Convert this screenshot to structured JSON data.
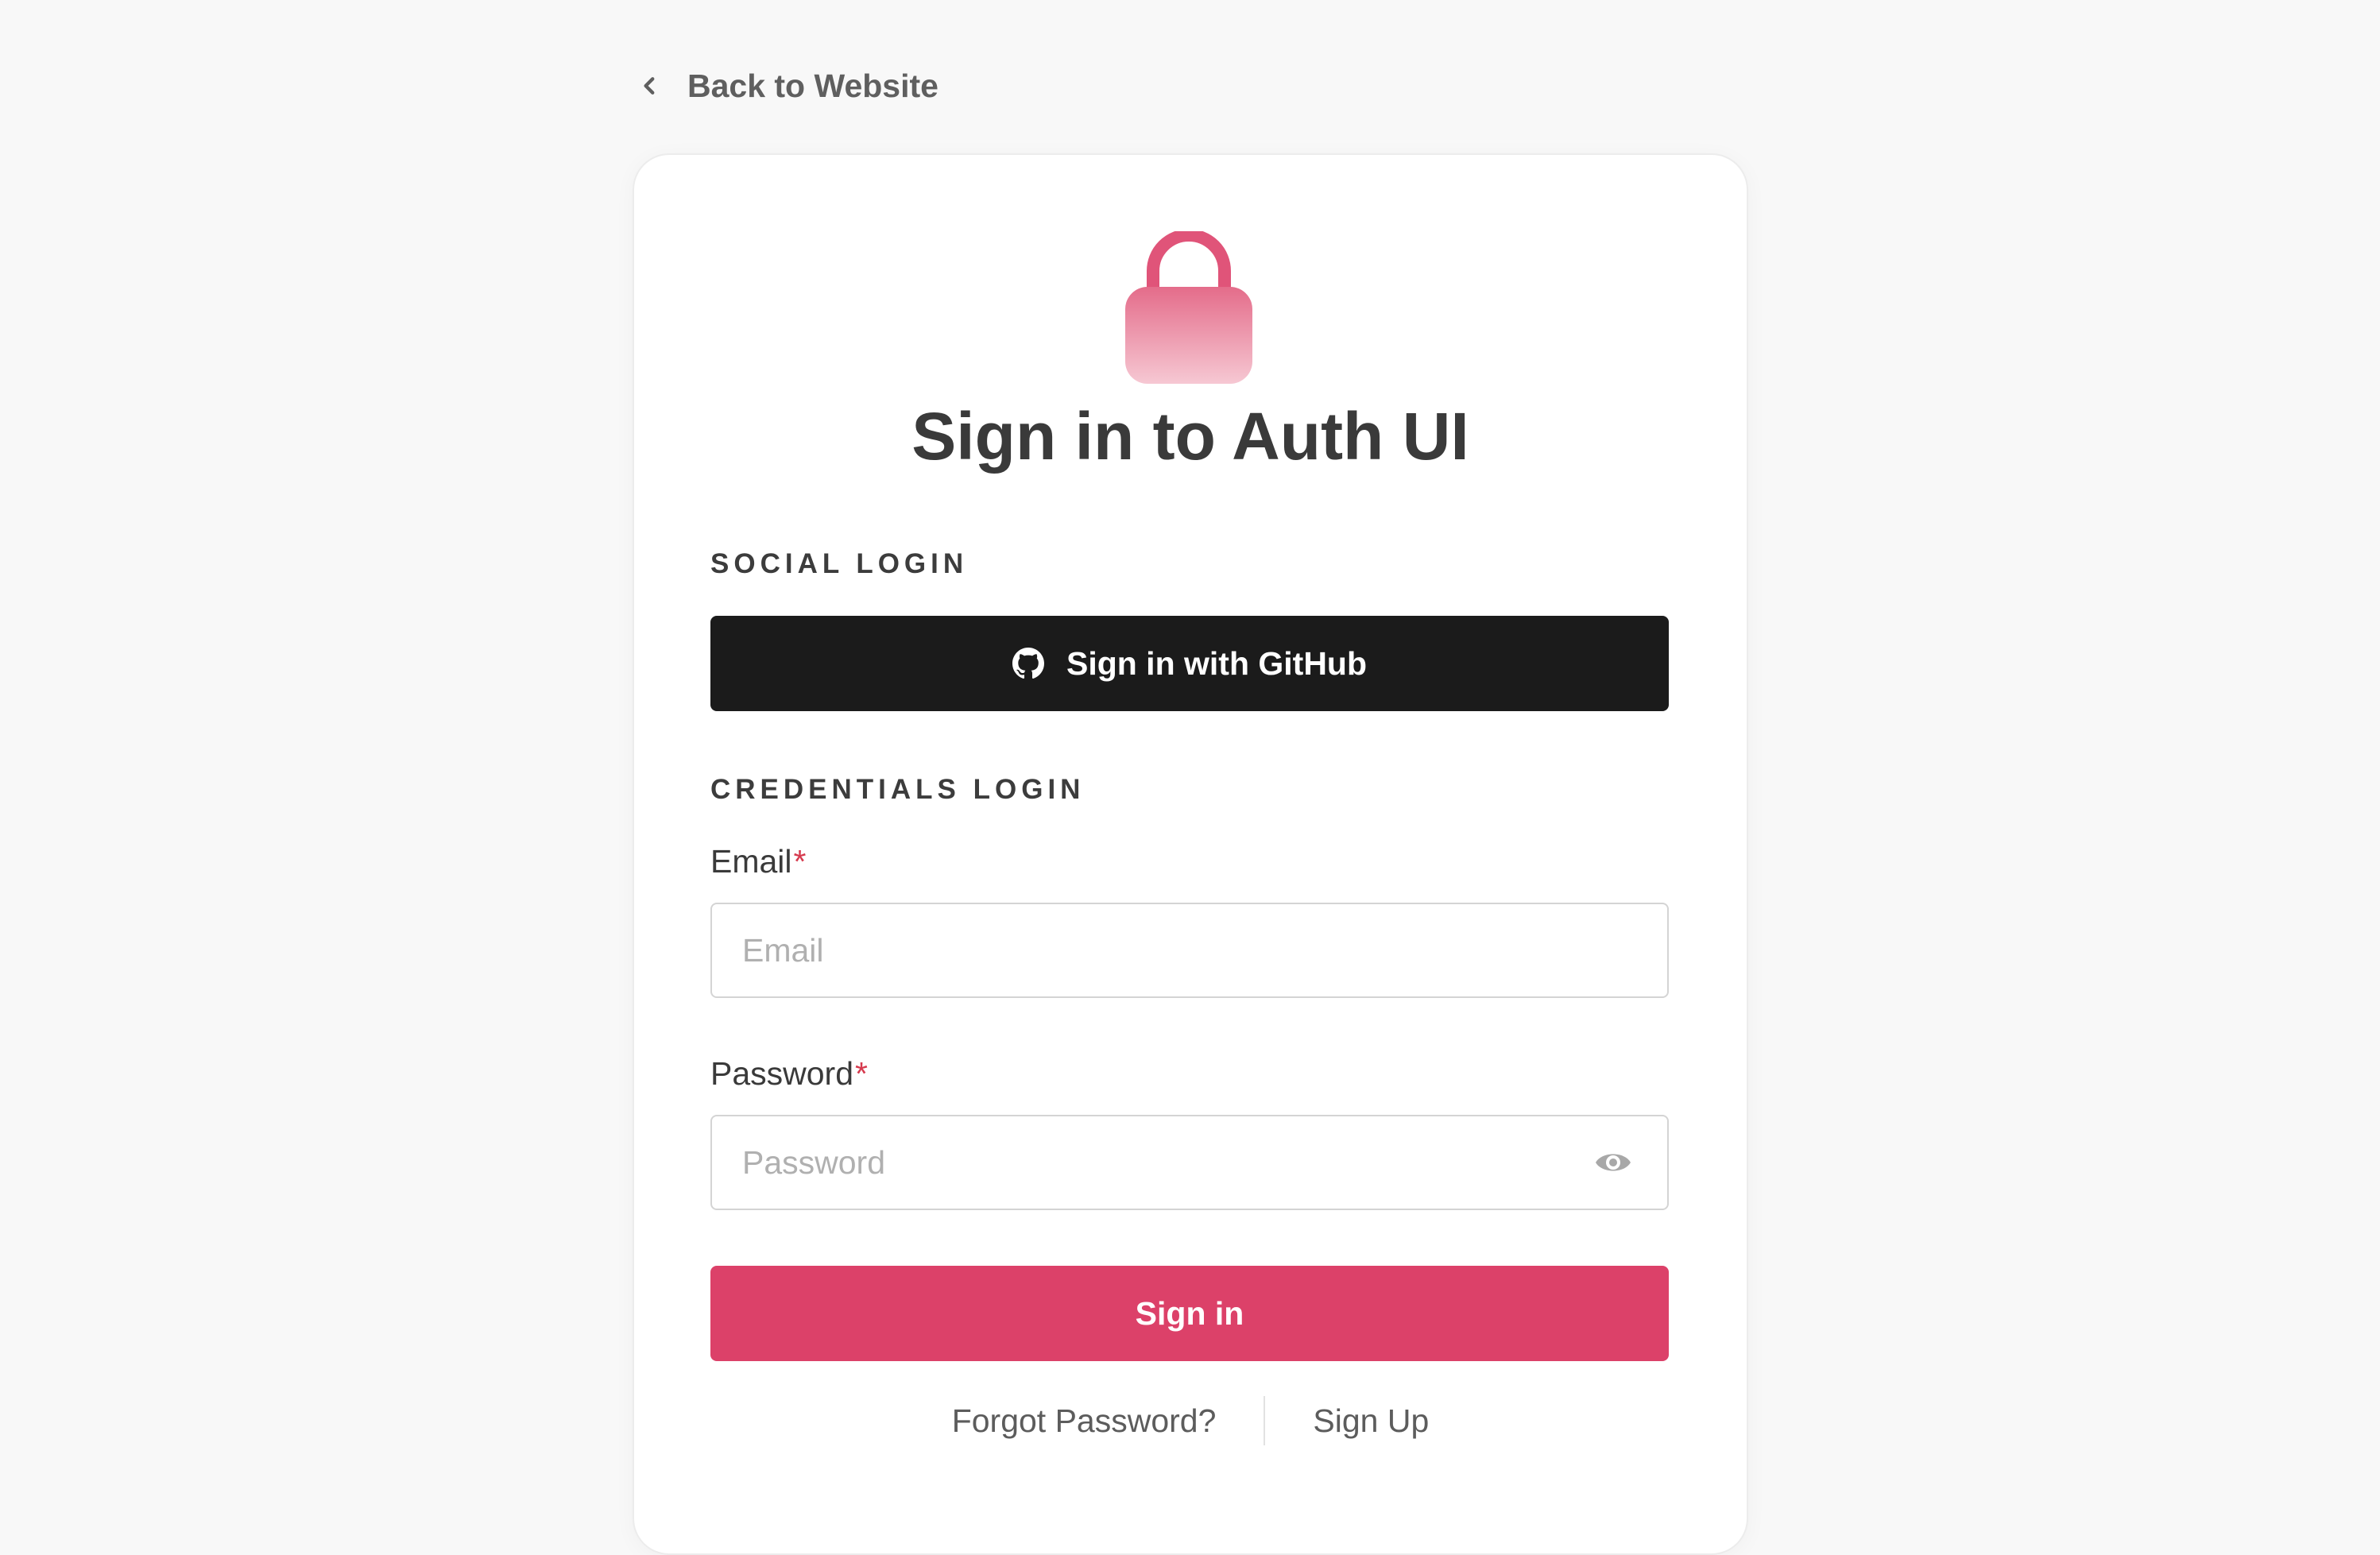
{
  "nav": {
    "back_label": "Back to Website"
  },
  "card": {
    "title": "Sign in to Auth UI",
    "social_section_label": "SOCIAL LOGIN",
    "github_button_label": "Sign in with GitHub",
    "credentials_section_label": "CREDENTIALS LOGIN"
  },
  "form": {
    "email": {
      "label": "Email",
      "required_mark": "*",
      "placeholder": "Email",
      "value": ""
    },
    "password": {
      "label": "Password",
      "required_mark": "*",
      "placeholder": "Password",
      "value": ""
    },
    "submit_label": "Sign in"
  },
  "footer": {
    "forgot_password_label": "Forgot Password?",
    "sign_up_label": "Sign Up"
  },
  "icons": {
    "back": "chevron-left-icon",
    "lock": "lock-icon",
    "github": "github-icon",
    "password_toggle": "eye-icon"
  },
  "colors": {
    "page_background": "#f8f8f8",
    "accent": "#dc4169",
    "lock_gradient_top": "#e46c8a",
    "lock_gradient_bottom": "#f6c8d3",
    "github_button": "#1b1b1b",
    "required": "#d63a4e"
  }
}
